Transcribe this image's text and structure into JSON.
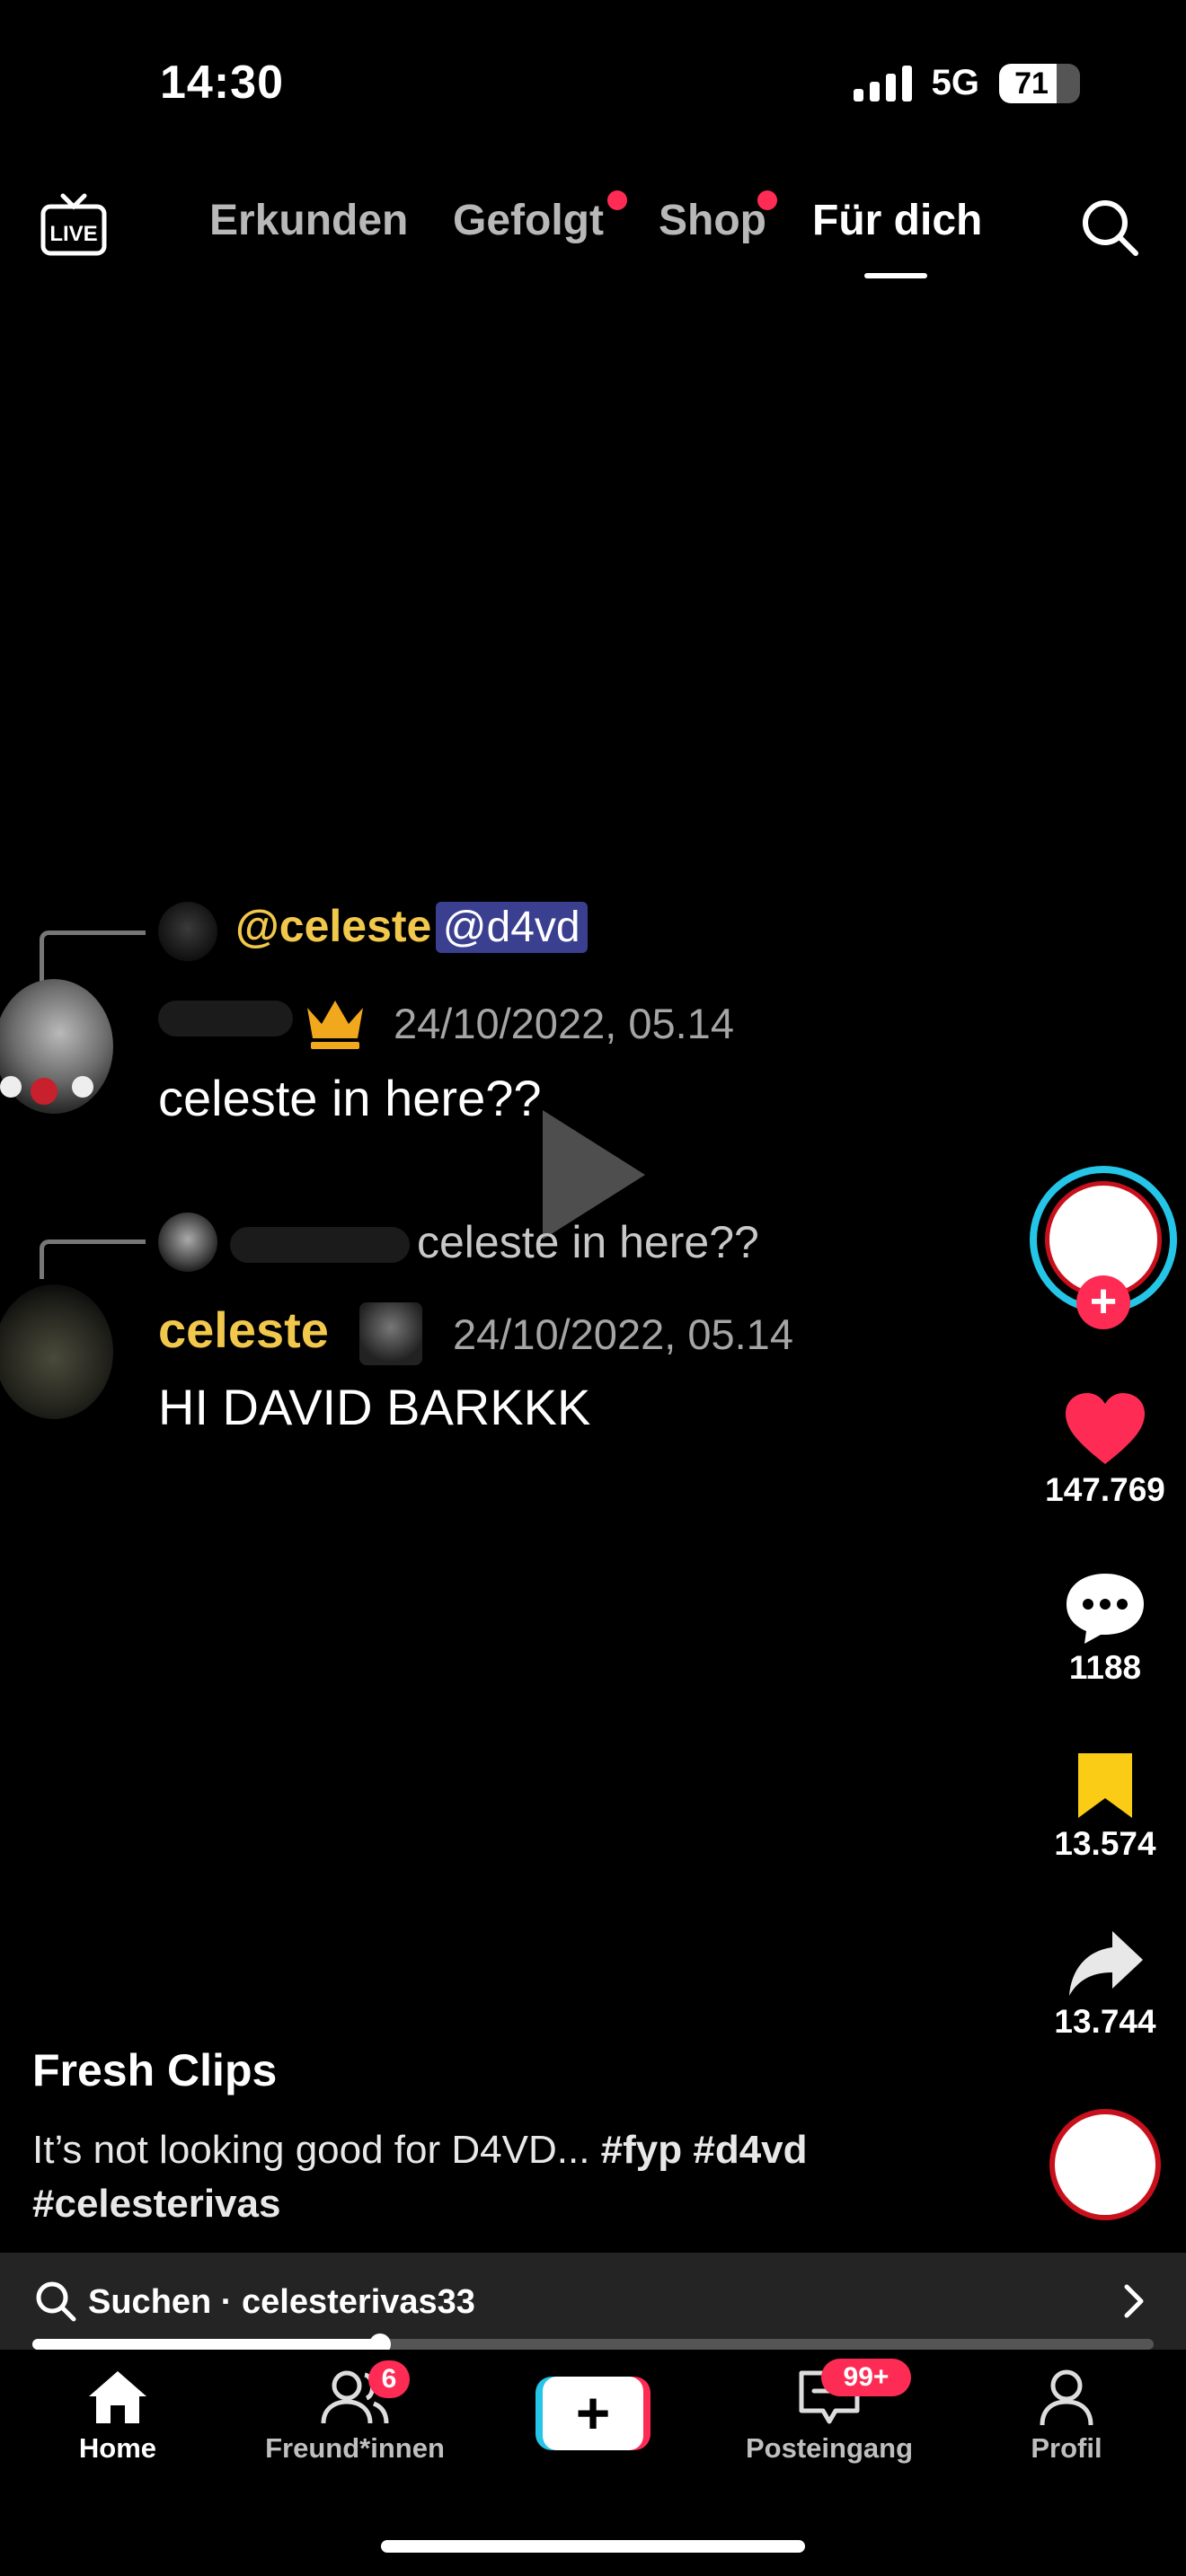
{
  "status_bar": {
    "time": "14:30",
    "network": "5G",
    "battery": "71",
    "battery_level": 0.71
  },
  "top_nav": {
    "live_icon": "live-tv-icon",
    "tabs": [
      {
        "label": "Erkunden",
        "dot": false
      },
      {
        "label": "Gefolgt",
        "dot": true
      },
      {
        "label": "Shop",
        "dot": true
      },
      {
        "label": "Für dich",
        "dot": false,
        "active": true
      }
    ],
    "search_icon": "search-icon"
  },
  "video_chat": {
    "reply1": {
      "mention": "@celeste",
      "tag": "@d4vd"
    },
    "msg1": {
      "timestamp": "24/10/2022, 05.14",
      "text": "celeste in here??"
    },
    "reply2": {
      "quoted": "celeste in here??"
    },
    "msg2": {
      "author": "celeste",
      "timestamp": "24/10/2022, 05.14",
      "text": "HI DAVID BARKKK"
    }
  },
  "actions": {
    "likes": "147.769",
    "comments": "1188",
    "saves": "13.574",
    "shares": "13.744",
    "like_color": "#fe2c55",
    "save_color": "#facc15"
  },
  "post": {
    "author": "Fresh Clips",
    "caption_text": "It’s not looking good for D4VD... ",
    "caption_tags_1": "#fyp #d4vd",
    "caption_tags_2": "#celesterivas"
  },
  "search": {
    "prefix": "Suchen · ",
    "query": "celesterivas33"
  },
  "progress": {
    "fraction": 0.31
  },
  "bottom_nav": {
    "home": "Home",
    "friends": "Freund*innen",
    "friends_badge": "6",
    "create": "+",
    "inbox": "Posteingang",
    "inbox_badge": "99+",
    "profile": "Profil"
  },
  "colors": {
    "accent": "#fe2c55",
    "cyan": "#25c5e8"
  }
}
